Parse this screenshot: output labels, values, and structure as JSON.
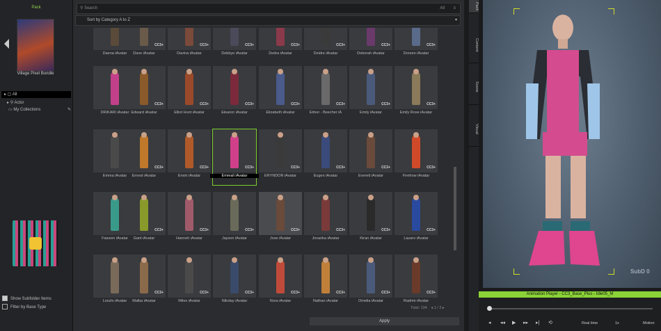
{
  "left_panel": {
    "tab": "Pack",
    "pack_title": "Village Pixel Bundle",
    "tree_root": "All",
    "tree_items": [
      "Actor",
      "My Collections"
    ],
    "options": [
      "Show Subfolder Items",
      "Filter by Base Type"
    ]
  },
  "search": {
    "placeholder": "Search",
    "filter": "All"
  },
  "sort": "Sort by Category A to Z",
  "grid": {
    "badge": "CC3+",
    "rows": [
      [
        "Daena iAvatar",
        "Dave iAvatar",
        "Davina iAvatar",
        "Debbye iAvatar",
        "Dedra iAvatar",
        "Deidre iAvatar",
        "Deborah iAvatar",
        "Doreen iAvatar"
      ],
      [
        "DRIKARI iAvatar",
        "Edward iAvatar",
        "Elliot Hunt iAvatar",
        "Eleanor iAvatar",
        "Elizabeth iAvatar",
        "Elmer - Beecher iA",
        "Emily iAvatar",
        "Emily Rose iAvatar"
      ],
      [
        "Emma iAvatar",
        "Ernest iAvatar",
        "Erwin iAvatar",
        "Emmali iAvatar",
        "ERYNDOR iAvatar",
        "Eugen iAvatar",
        "Everett iAvatar",
        "Firefrow iAvatar"
      ],
      [
        "Fawzen iAvatar",
        "Gant iAvatar",
        "Hanneh iAvatar",
        "Jayson iAvatar",
        "Jose iAvatar",
        "Jovanka iAvatar",
        "Kiran iAvatar",
        "Lazaro iAvatar"
      ],
      [
        "Leszlo iAvatar",
        "Malba iAvatar",
        "Miles iAvatar",
        "Nikolay iAvatar",
        "Nora iAvatar",
        "Nathan iAvatar",
        "Omelia iAvatar",
        "Radmir iAvatar"
      ]
    ],
    "outfit_colors": [
      [
        "#5a4a3a",
        "#6a5a4a",
        "#7a4a3a",
        "#4a4a5a",
        "#8a3a4a",
        "#3a3a3a",
        "#6a3a6a",
        "#5a6a8a"
      ],
      [
        "#c2408a",
        "#8a5a2a",
        "#9a4a2a",
        "#7a2a3a",
        "#4a5a8a",
        "#6a6a6a",
        "#4a5a7a",
        "#8a7a5a"
      ],
      [
        "#4a4a4a",
        "#c0782a",
        "#b05a2a",
        "#d0408a",
        "#3a3a3a",
        "#3a4a7a",
        "#6a4a3a",
        "#d04a2a"
      ],
      [
        "#3a9a8a",
        "#8a9a2a",
        "#a05a6a",
        "#6a6a5a",
        "#6a4a3a",
        "#7a3a3a",
        "#2a2a2a",
        "#2a4aa0"
      ],
      [
        "#7a6a5a",
        "#8a6a4a",
        "#4a4a4a",
        "#3a4a6a",
        "#c04a3a",
        "#c0803a",
        "#4a5a7a",
        "#6a3a2a"
      ]
    ],
    "selected": "Emmali iAvatar",
    "hover": "Jose iAvatar"
  },
  "pager": {
    "total": "Total: 194",
    "page": "1 / 2"
  },
  "apply": "Apply",
  "side_tabs": [
    "Pack",
    "Content",
    "Scene",
    "Visual"
  ],
  "viewport": {
    "subd": "SubD 0"
  },
  "animation_player": {
    "title": "Animation Player - CC3_Base_Plus - Idle05_M",
    "speed_label": "Real time",
    "speed_value": "1x",
    "motion_label": "Motion"
  }
}
